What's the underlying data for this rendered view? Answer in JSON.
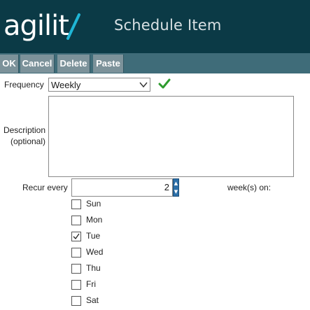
{
  "header": {
    "logo_text": "agilit",
    "title": "Schedule Item"
  },
  "toolbar": {
    "buttons": [
      {
        "label": "OK"
      },
      {
        "label": "Cancel"
      },
      {
        "label": "Delete"
      },
      {
        "label": "Paste"
      }
    ]
  },
  "form": {
    "frequency_label": "Frequency",
    "frequency_value": "Weekly",
    "description_label_line1": "Description",
    "description_label_line2": "(optional)",
    "description_value": "",
    "recur_label": "Recur every",
    "recur_value": "2",
    "recur_suffix": "week(s) on:",
    "days": [
      {
        "label": "Sun",
        "checked": false
      },
      {
        "label": "Mon",
        "checked": false
      },
      {
        "label": "Tue",
        "checked": true
      },
      {
        "label": "Wed",
        "checked": false
      },
      {
        "label": "Thu",
        "checked": false
      },
      {
        "label": "Fri",
        "checked": false
      },
      {
        "label": "Sat",
        "checked": false
      }
    ]
  },
  "colors": {
    "header_bg": "#0b3a46",
    "toolbar_bg": "#3f6c79",
    "button_bg": "#7c929a",
    "ok_check": "#2e9b2e",
    "accent": "#1fb6d6"
  },
  "icons": {
    "validation": "checkmark-icon",
    "dropdown": "chevron-down-icon",
    "spinner_up": "spin-up-icon",
    "spinner_down": "spin-down-icon"
  }
}
